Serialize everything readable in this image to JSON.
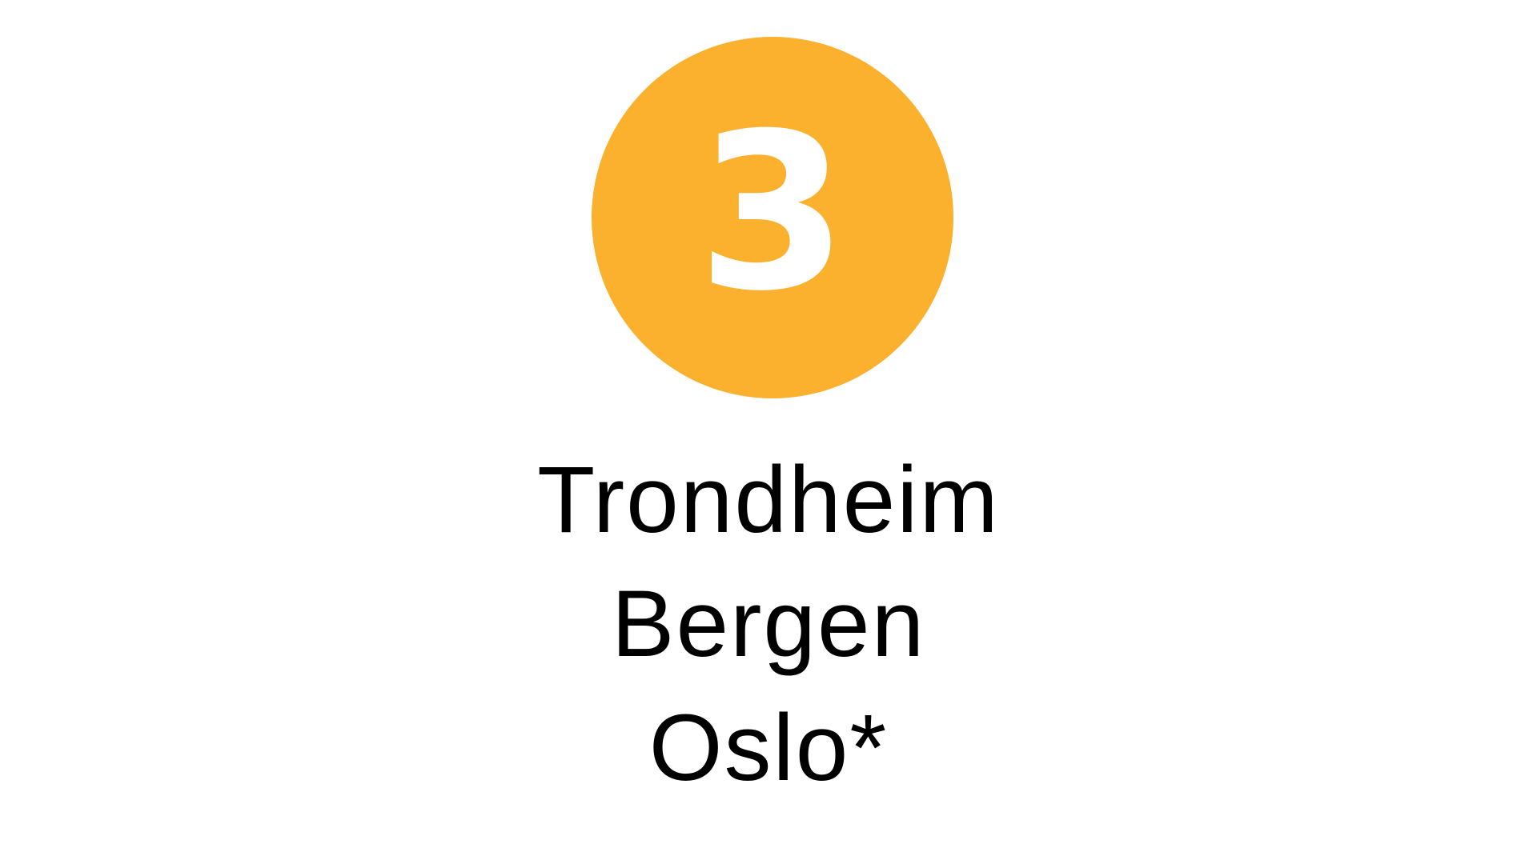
{
  "badge": {
    "number": "3",
    "color": "#fbb02e"
  },
  "cities": [
    "Trondheim",
    "Bergen",
    "Oslo*"
  ]
}
